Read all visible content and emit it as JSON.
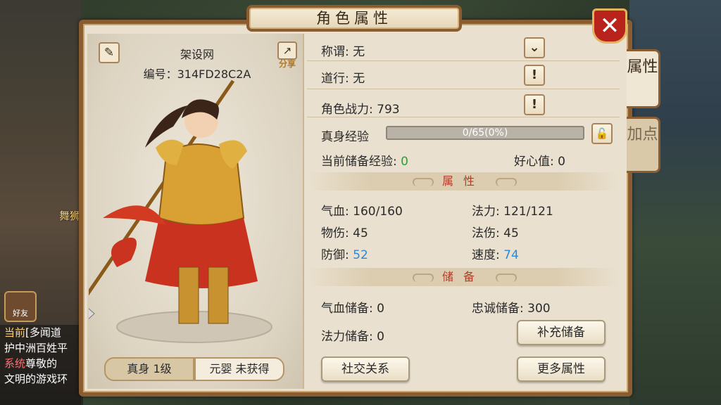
{
  "window": {
    "title": "角色属性",
    "close": "✕"
  },
  "side_tabs": [
    {
      "label": "属性"
    },
    {
      "label": "加点"
    }
  ],
  "character": {
    "name": "架设网",
    "id_label": "编号：314FD28C2A",
    "share_label": "分享"
  },
  "modes": {
    "active": "真身 1级",
    "inactive": "元婴 未获得"
  },
  "info": {
    "title_label": "称谓: ",
    "title_value": "无",
    "dao_label": "道行: ",
    "dao_value": "无",
    "power_label": "角色战力: ",
    "power_value": "793",
    "exp_label": "真身经验",
    "exp_text": "0/65(0%)",
    "exp_progress": 0,
    "stored_exp_label": "当前储备经验: ",
    "stored_exp_value": "0",
    "kindness_label": "好心值: ",
    "kindness_value": "0"
  },
  "attributes": {
    "header": "属性",
    "hp_label": "气血: ",
    "hp_value": "160/160",
    "mp_label": "法力: ",
    "mp_value": "121/121",
    "phys_label": "物伤: ",
    "phys_value": "45",
    "mag_label": "法伤: ",
    "mag_value": "45",
    "def_label": "防御: ",
    "def_value": "52",
    "spd_label": "速度: ",
    "spd_value": "74"
  },
  "reserve": {
    "header": "储备",
    "hp_res_label": "气血储备: ",
    "hp_res_value": "0",
    "loyal_label": "忠诚储备: ",
    "loyal_value": "300",
    "mp_res_label": "法力储备: ",
    "mp_res_value": "0",
    "refill_button": "补充储备"
  },
  "buttons": {
    "social": "社交关系",
    "more": "更多属性"
  },
  "background": {
    "dance_label": "舞狮",
    "friend_button": "好友",
    "chat_lines": [
      {
        "tag": "当前",
        "text": "[多闻道"
      },
      {
        "tag": "",
        "text": "护中洲百姓平"
      },
      {
        "tag": "系统",
        "text": "尊敬的"
      },
      {
        "tag": "",
        "text": "文明的游戏环"
      }
    ]
  },
  "colors": {
    "accent_red": "#b23b28",
    "value_green": "#25a32f",
    "value_blue": "#2b87df",
    "frame_brown": "#8a5c32"
  }
}
